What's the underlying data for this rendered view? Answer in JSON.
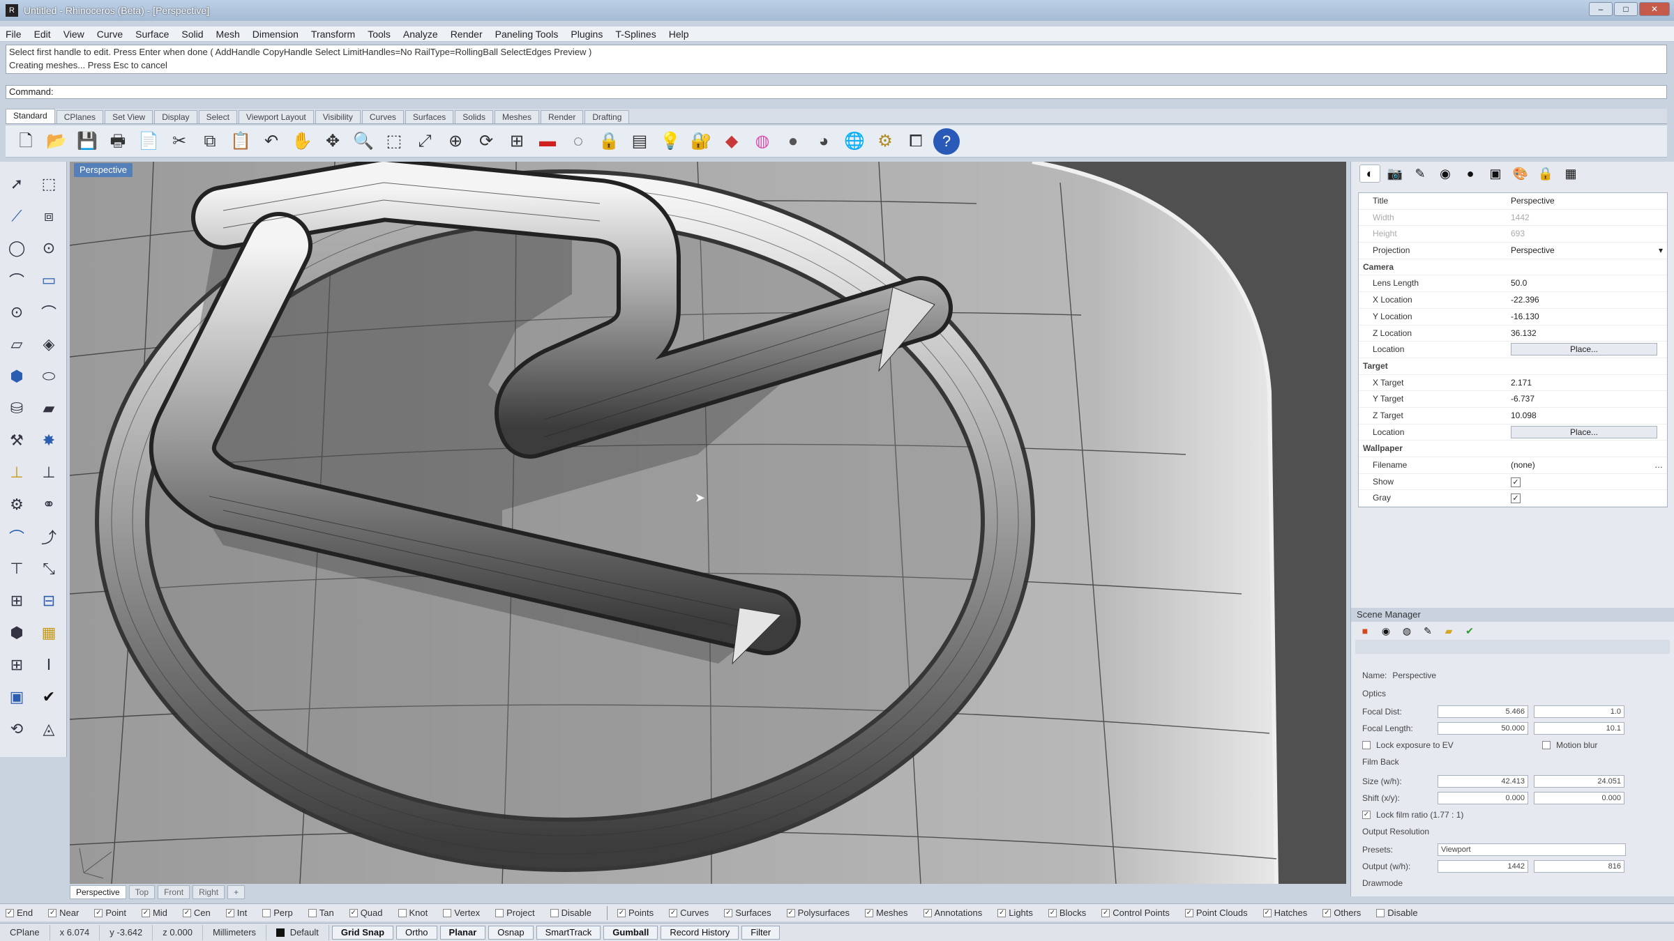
{
  "window": {
    "title": "Untitled - Rhinoceros (Beta) - [Perspective]",
    "app_icon": "R"
  },
  "window_controls": {
    "minimize": "–",
    "maximize": "□",
    "close": "✕"
  },
  "menu": [
    "File",
    "Edit",
    "View",
    "Curve",
    "Surface",
    "Solid",
    "Mesh",
    "Dimension",
    "Transform",
    "Tools",
    "Analyze",
    "Render",
    "Paneling Tools",
    "Plugins",
    "T-Splines",
    "Help"
  ],
  "command_history": [
    "Select first handle to edit. Press Enter when done ( AddHandle  CopyHandle  Select  LimitHandles=No  RailType=RollingBall  SelectEdges  Preview )",
    "Creating meshes... Press Esc to cancel"
  ],
  "command_prompt": "Command:",
  "toolbar_tabs": [
    "Standard",
    "CPlanes",
    "Set View",
    "Display",
    "Select",
    "Viewport Layout",
    "Visibility",
    "Curves",
    "Surfaces",
    "Solids",
    "Meshes",
    "Render",
    "Drafting"
  ],
  "toolbar_icons": [
    "new-icon",
    "open-icon",
    "save-icon",
    "print-icon",
    "import-icon",
    "cut-icon",
    "copy-icon",
    "paste-icon",
    "undo-icon",
    "pan-icon",
    "rotate-icon",
    "zoom-icon",
    "zoom-window-icon",
    "zoom-extents-icon",
    "zoom-selected-icon",
    "rotate-view-icon",
    "viewport-layout-icon",
    "hide-icon",
    "show-icon",
    "lock-icon",
    "layer-icon",
    "light-icon",
    "lock-object-icon",
    "material-icon",
    "color-wheel-icon",
    "render-preview-icon",
    "shaded-icon",
    "environment-icon",
    "options-icon",
    "selection-icon",
    "help-icon"
  ],
  "viewport": {
    "label": "Perspective",
    "tabs": [
      "Perspective",
      "Top",
      "Front",
      "Right",
      "+"
    ]
  },
  "properties": {
    "tabs": [
      "object-properties-icon",
      "camera-icon",
      "light-icon",
      "material-icon",
      "environment-icon",
      "texture-icon",
      "render-icon",
      "notes-icon",
      "grid-icon"
    ],
    "rows": [
      {
        "label": "Title",
        "value": "Perspective",
        "type": "text"
      },
      {
        "label": "Width",
        "value": "1442",
        "type": "text",
        "disabled": true
      },
      {
        "label": "Height",
        "value": "693",
        "type": "text",
        "disabled": true
      },
      {
        "label": "Projection",
        "value": "Perspective",
        "type": "dropdown"
      },
      {
        "label": "Camera",
        "type": "section"
      },
      {
        "label": "Lens Length",
        "value": "50.0",
        "type": "text"
      },
      {
        "label": "X Location",
        "value": "-22.396",
        "type": "text"
      },
      {
        "label": "Y Location",
        "value": "-16.130",
        "type": "text"
      },
      {
        "label": "Z Location",
        "value": "36.132",
        "type": "text"
      },
      {
        "label": "Location",
        "value": "Place...",
        "type": "button"
      },
      {
        "label": "Target",
        "type": "section"
      },
      {
        "label": "X Target",
        "value": "2.171",
        "type": "text"
      },
      {
        "label": "Y Target",
        "value": "-6.737",
        "type": "text"
      },
      {
        "label": "Z Target",
        "value": "10.098",
        "type": "text"
      },
      {
        "label": "Location",
        "value": "Place...",
        "type": "button"
      },
      {
        "label": "Wallpaper",
        "type": "section"
      },
      {
        "label": "Filename",
        "value": "(none)",
        "type": "file"
      },
      {
        "label": "Show",
        "value": "✓",
        "type": "check"
      },
      {
        "label": "Gray",
        "value": "✓",
        "type": "check"
      }
    ]
  },
  "scene_manager": {
    "title": "Scene Manager",
    "name_label": "Name:",
    "name_value": "Perspective",
    "optics_label": "Optics",
    "rows": [
      {
        "label": "Focal Dist:",
        "v1": "5.466",
        "v2": "1.0"
      },
      {
        "label": "Focal Length:",
        "v1": "50.000",
        "v2": "10.1"
      },
      {
        "label": "Size (w/h):",
        "v1": "42.413",
        "v2": "24.051"
      },
      {
        "label": "Shift (x/y):",
        "v1": "0.000",
        "v2": "0.000"
      }
    ],
    "lock_exposure": "Lock exposure to EV",
    "motion_blur": "Motion blur",
    "film_back": "Film Back",
    "lock_film_ratio": "Lock film ratio (1.77 : 1)",
    "output_res": "Output Resolution",
    "presets_label": "Presets:",
    "presets_value": "Viewport",
    "output_label": "Output (w/h):",
    "output_w": "1442",
    "output_h": "816",
    "draw_mode": "Drawmode"
  },
  "osnaps": [
    {
      "label": "End",
      "on": true
    },
    {
      "label": "Near",
      "on": true
    },
    {
      "label": "Point",
      "on": true
    },
    {
      "label": "Mid",
      "on": true
    },
    {
      "label": "Cen",
      "on": true
    },
    {
      "label": "Int",
      "on": true
    },
    {
      "label": "Perp",
      "on": false
    },
    {
      "label": "Tan",
      "on": false
    },
    {
      "label": "Quad",
      "on": true
    },
    {
      "label": "Knot",
      "on": false
    },
    {
      "label": "Vertex",
      "on": false
    },
    {
      "label": "Project",
      "on": false
    },
    {
      "label": "Disable",
      "on": false
    }
  ],
  "filters": [
    {
      "label": "Points",
      "on": true
    },
    {
      "label": "Curves",
      "on": true
    },
    {
      "label": "Surfaces",
      "on": true
    },
    {
      "label": "Polysurfaces",
      "on": true
    },
    {
      "label": "Meshes",
      "on": true
    },
    {
      "label": "Annotations",
      "on": true
    },
    {
      "label": "Lights",
      "on": true
    },
    {
      "label": "Blocks",
      "on": true
    },
    {
      "label": "Control Points",
      "on": true
    },
    {
      "label": "Point Clouds",
      "on": true
    },
    {
      "label": "Hatches",
      "on": true
    },
    {
      "label": "Others",
      "on": true
    },
    {
      "label": "Disable",
      "on": false
    }
  ],
  "status": {
    "cplane": "CPlane",
    "x": "x 6.074",
    "y": "y -3.642",
    "z": "z 0.000",
    "units": "Millimeters",
    "layer": "Default",
    "panes": [
      {
        "label": "Grid Snap",
        "on": true
      },
      {
        "label": "Ortho",
        "on": false
      },
      {
        "label": "Planar",
        "on": true
      },
      {
        "label": "Osnap",
        "on": false
      },
      {
        "label": "SmartTrack",
        "on": false
      },
      {
        "label": "Gumball",
        "on": true
      },
      {
        "label": "Record History",
        "on": false
      },
      {
        "label": "Filter",
        "on": false
      }
    ]
  }
}
